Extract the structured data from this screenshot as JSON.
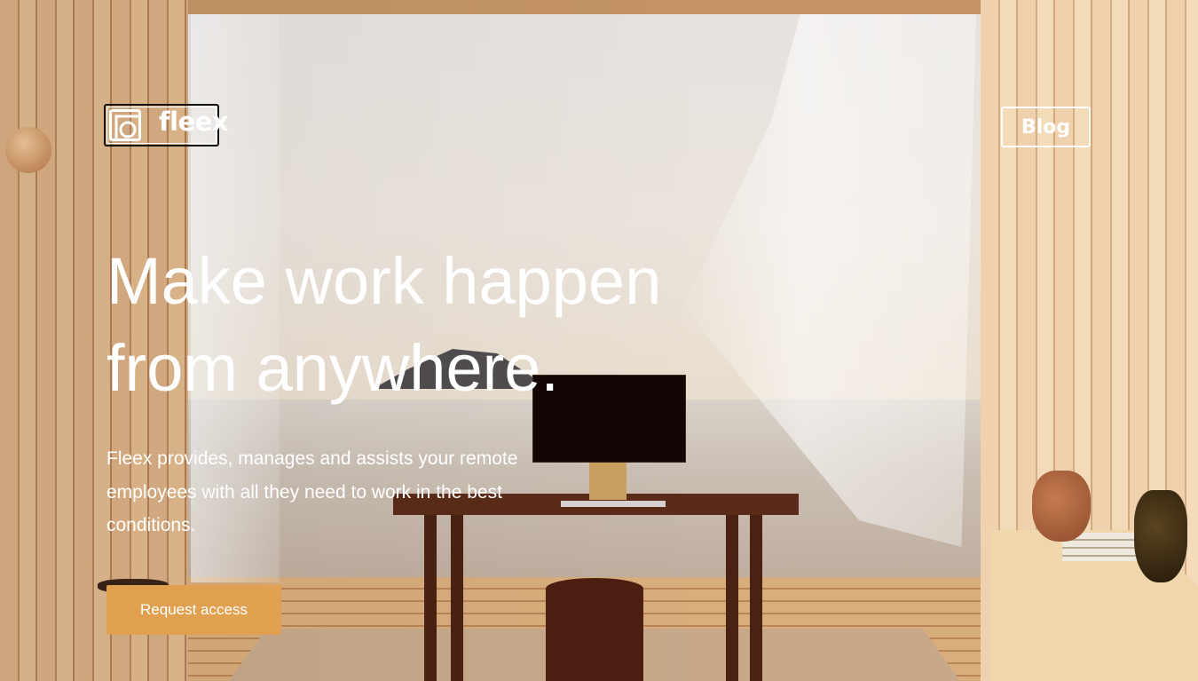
{
  "header": {
    "logo_text": "fleex",
    "blog_label": "Blog"
  },
  "hero": {
    "headline_line1": "Make work happen",
    "headline_line2": "from anywhere.",
    "subtitle": "Fleex provides, manages and assists your remote employees with all they need to work in the best conditions.",
    "cta_label": "Request access"
  },
  "colors": {
    "accent": "#e0a050",
    "text": "#ffffff"
  },
  "icons": {
    "logo_mark": "fleex-logo-icon"
  }
}
